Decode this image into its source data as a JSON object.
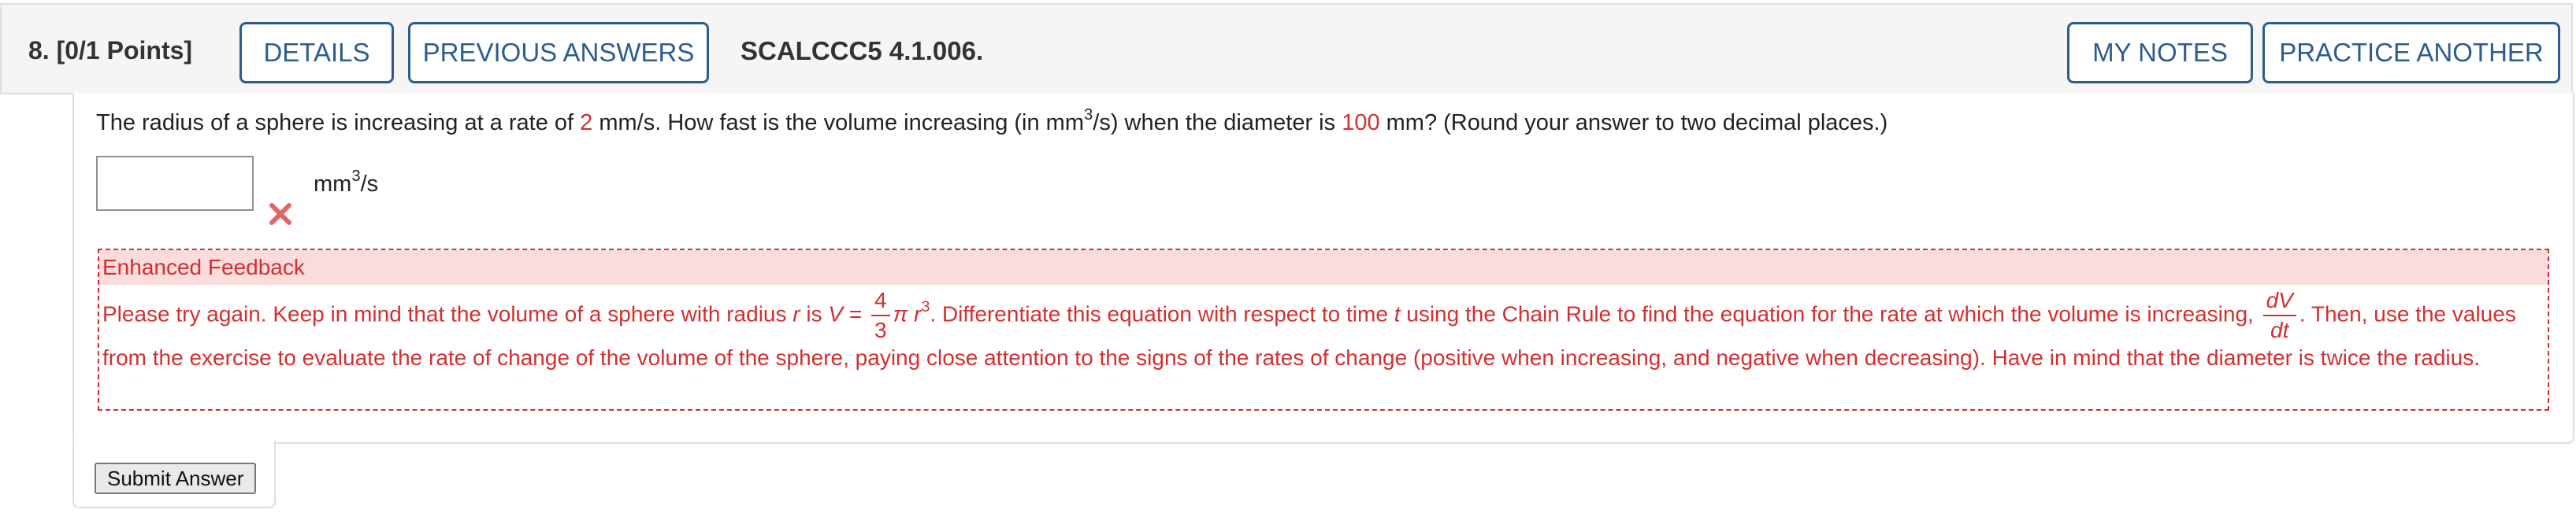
{
  "header": {
    "question_number": "8.",
    "points": "[0/1 Points]",
    "details_label": "DETAILS",
    "previous_answers_label": "PREVIOUS ANSWERS",
    "code": "SCALCCC5 4.1.006.",
    "my_notes_label": "MY NOTES",
    "practice_another_label": "PRACTICE ANOTHER"
  },
  "question": {
    "part1": "The radius of a sphere is increasing at a rate of ",
    "rate": "2",
    "part2": " mm/s. How fast is the volume increasing (in mm",
    "exp": "3",
    "part3": "/s) when the diameter is ",
    "diameter": "100",
    "part4": " mm? (Round your answer to two decimal places.)"
  },
  "answer": {
    "value": "",
    "unit_base": "mm",
    "unit_exp": "3",
    "unit_tail": "/s"
  },
  "feedback": {
    "title": "Enhanced Feedback",
    "t1": "Please try again. Keep in mind that the volume of a sphere with radius ",
    "r_var": "r",
    "t2": " is ",
    "v_var": "V",
    "t3": " = ",
    "frac_num": "4",
    "frac_den": "3",
    "pi": "π",
    "r_var2": "r",
    "r_exp": "3",
    "t4": ". Differentiate this equation with respect to time ",
    "t_var": "t",
    "t5": " using the Chain Rule to find the equation for the rate at which the volume is increasing, ",
    "dv": "dV",
    "dt": "dt",
    "t6": ". Then, use the values from the exercise to evaluate the rate of change of the volume of the sphere, paying close attention to the signs of the rates of change (positive when increasing, and negative when decreasing). Have in mind that the diameter is twice the radius."
  },
  "submit_label": "Submit Answer",
  "colors": {
    "accent": "#2c5d8f",
    "error": "#d32f2f",
    "feedback_bg": "#fadcdc"
  }
}
